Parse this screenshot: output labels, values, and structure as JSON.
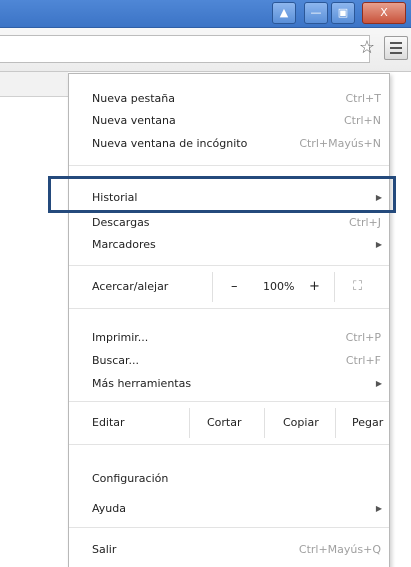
{
  "window": {
    "min_glyph": "▲",
    "dash_glyph": "—",
    "max_glyph": "▣",
    "close_glyph": "X"
  },
  "toolbar": {
    "star_icon": "☆",
    "menu_icon": "hamburger-menu-icon"
  },
  "menu": {
    "new_tab": {
      "label": "Nueva pestaña",
      "shortcut": "Ctrl+T"
    },
    "new_window": {
      "label": "Nueva ventana",
      "shortcut": "Ctrl+N"
    },
    "incognito": {
      "label": "Nueva ventana de incógnito",
      "shortcut": "Ctrl+Mayús+N"
    },
    "history": {
      "label": "Historial",
      "arrow": "▶"
    },
    "downloads": {
      "label": "Descargas",
      "shortcut": "Ctrl+J"
    },
    "bookmarks": {
      "label": "Marcadores",
      "arrow": "▶"
    },
    "zoom": {
      "label": "Acercar/alejar",
      "minus": "–",
      "value": "100%",
      "plus": "+",
      "fullscreen": "⛶"
    },
    "print": {
      "label": "Imprimir...",
      "shortcut": "Ctrl+P"
    },
    "find": {
      "label": "Buscar...",
      "shortcut": "Ctrl+F"
    },
    "more_tools": {
      "label": "Más herramientas",
      "arrow": "▶"
    },
    "edit": {
      "label": "Editar",
      "cut": "Cortar",
      "copy": "Copiar",
      "paste": "Pegar"
    },
    "settings": {
      "label": "Configuración"
    },
    "help": {
      "label": "Ayuda",
      "arrow": "▶"
    },
    "exit": {
      "label": "Salir",
      "shortcut": "Ctrl+Mayús+Q"
    }
  },
  "colors": {
    "highlight_border": "#244a7c",
    "titlebar": "#3c74c6"
  }
}
